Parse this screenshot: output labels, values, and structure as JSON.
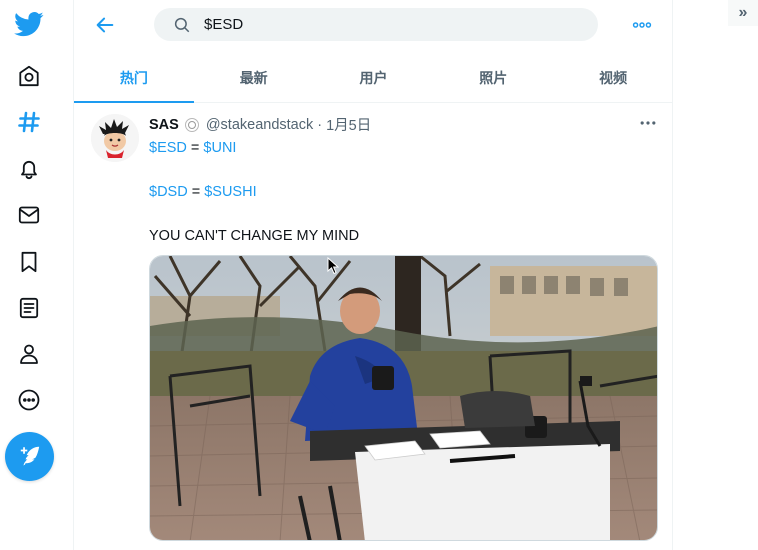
{
  "nav": {
    "items": [
      {
        "name": "twitter-logo-icon"
      },
      {
        "name": "home-icon"
      },
      {
        "name": "explore-hashtag-icon"
      },
      {
        "name": "notifications-bell-icon"
      },
      {
        "name": "messages-mail-icon"
      },
      {
        "name": "bookmarks-icon"
      },
      {
        "name": "lists-icon"
      },
      {
        "name": "profile-icon"
      },
      {
        "name": "more-icon"
      }
    ],
    "compose": {
      "name": "compose-tweet-icon"
    }
  },
  "header": {
    "search_value": "$ESD"
  },
  "tabs": [
    {
      "label": "热门",
      "active": true
    },
    {
      "label": "最新",
      "active": false
    },
    {
      "label": "用户",
      "active": false
    },
    {
      "label": "照片",
      "active": false
    },
    {
      "label": "视频",
      "active": false
    }
  ],
  "tweet": {
    "name": "SAS",
    "handle": "@stakeandstack",
    "separator": "·",
    "date": "1月5日",
    "line1": {
      "a": "$ESD",
      "eq": " = ",
      "b": "$UNI"
    },
    "line2": {
      "a": "$DSD",
      "eq": " = ",
      "b": "$SUSHI"
    },
    "line3": "YOU CAN'T CHANGE MY MIND"
  },
  "collapse_label": "»",
  "colors": {
    "accent": "#1d9bf0",
    "text": "#0f1419",
    "muted": "#536471"
  }
}
